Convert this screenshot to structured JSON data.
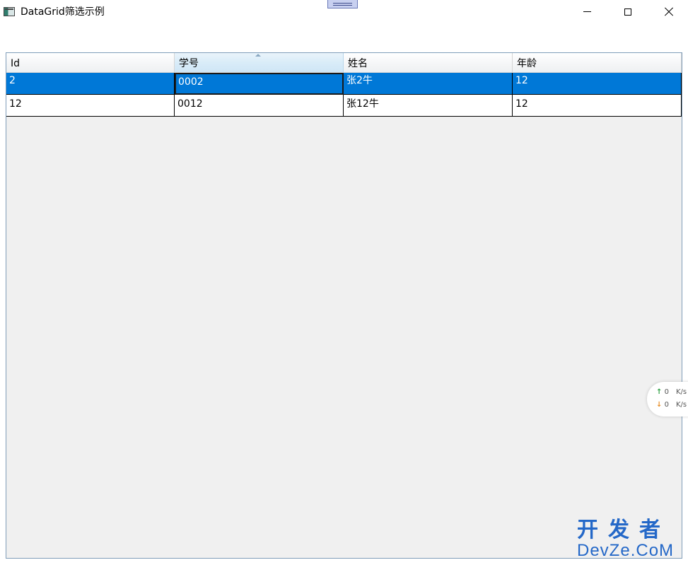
{
  "window": {
    "title": "DataGrid筛选示例"
  },
  "grid": {
    "columns": [
      {
        "label": "Id"
      },
      {
        "label": "学号"
      },
      {
        "label": "姓名"
      },
      {
        "label": "年龄"
      }
    ],
    "rows": [
      {
        "id": "2",
        "student_no": "0002",
        "name": "张2牛",
        "age": "12"
      },
      {
        "id": "12",
        "student_no": "0012",
        "name": "张12牛",
        "age": "12"
      }
    ],
    "selected_color": "#0078d7"
  },
  "netspeed": {
    "up_value": "0",
    "up_unit": "K/s",
    "down_value": "0",
    "down_unit": "K/s"
  },
  "watermark": {
    "cn": "开发者",
    "en": "DevZe.CoM"
  },
  "icons": [
    "app-icon",
    "minimize-icon",
    "maximize-icon",
    "close-icon",
    "sort-ascending-icon",
    "arrow-up-icon",
    "arrow-down-icon"
  ]
}
